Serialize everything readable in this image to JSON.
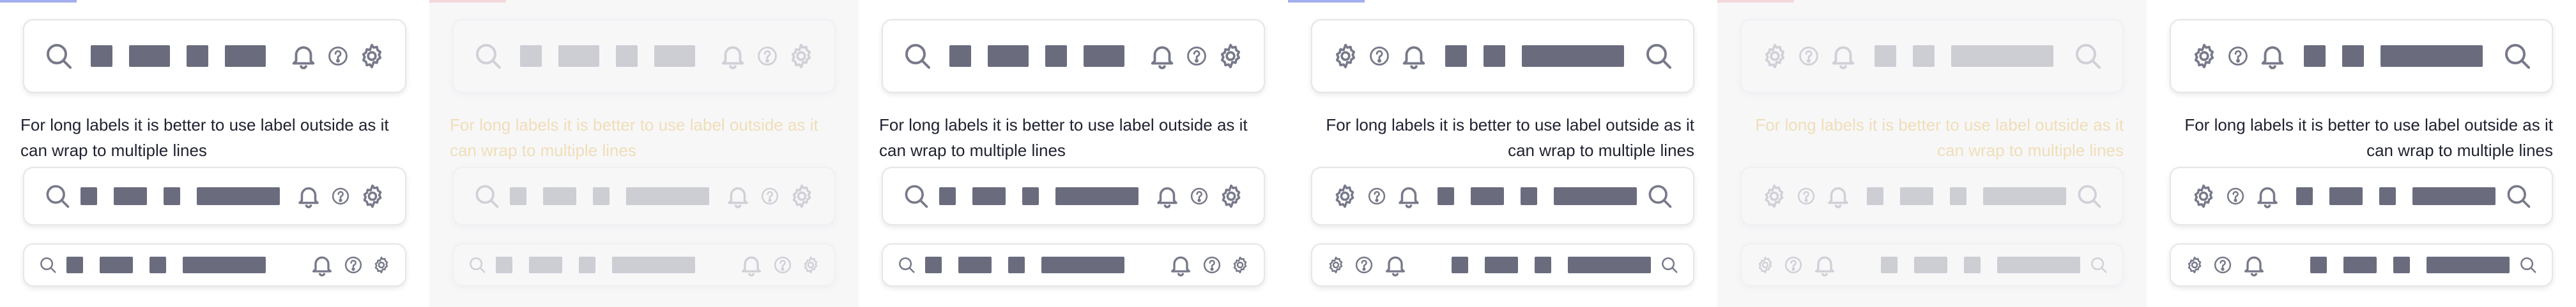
{
  "long_label_text": "For long labels it is better to use label outside as it can wrap to multiple lines",
  "colors": {
    "card_border": "#e6e6ea",
    "icon": "#77798a",
    "placeholder_block": "#6a6c7e",
    "label": "#1f2130",
    "warning_label": "#e7a61a",
    "accent": "#5a6ee0",
    "warning_accent": "#e03a3a"
  },
  "icons": {
    "search": "search-icon",
    "notifications": "bell-icon",
    "help": "help-circle-icon",
    "settings": "gear-icon"
  },
  "panels": [
    {
      "variant": "ltr",
      "state": "default"
    },
    {
      "variant": "ltr",
      "state": "disabled-warning"
    },
    {
      "variant": "ltr",
      "state": "default"
    },
    {
      "variant": "rtl",
      "state": "default"
    },
    {
      "variant": "rtl",
      "state": "disabled-warning"
    },
    {
      "variant": "rtl",
      "state": "default"
    }
  ]
}
